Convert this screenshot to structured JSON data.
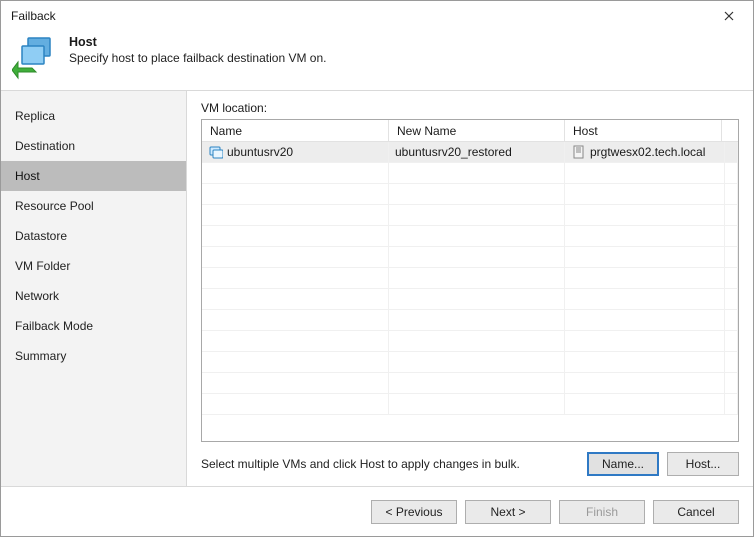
{
  "window": {
    "title": "Failback"
  },
  "header": {
    "title": "Host",
    "subtitle": "Specify host to place failback destination VM on."
  },
  "sidebar": {
    "items": [
      {
        "label": "Replica",
        "active": false
      },
      {
        "label": "Destination",
        "active": false
      },
      {
        "label": "Host",
        "active": true
      },
      {
        "label": "Resource Pool",
        "active": false
      },
      {
        "label": "Datastore",
        "active": false
      },
      {
        "label": "VM Folder",
        "active": false
      },
      {
        "label": "Network",
        "active": false
      },
      {
        "label": "Failback Mode",
        "active": false
      },
      {
        "label": "Summary",
        "active": false
      }
    ]
  },
  "main": {
    "location_label": "VM location:",
    "columns": {
      "name": "Name",
      "new_name": "New Name",
      "host": "Host"
    },
    "rows": [
      {
        "name": "ubuntusrv20",
        "new_name": "ubuntusrv20_restored",
        "host": "prgtwesx02.tech.local",
        "selected": true
      }
    ],
    "hint": "Select multiple VMs and click Host to apply changes in bulk.",
    "name_button": "Name...",
    "host_button": "Host..."
  },
  "footer": {
    "previous": "< Previous",
    "next": "Next >",
    "finish": "Finish",
    "cancel": "Cancel"
  }
}
